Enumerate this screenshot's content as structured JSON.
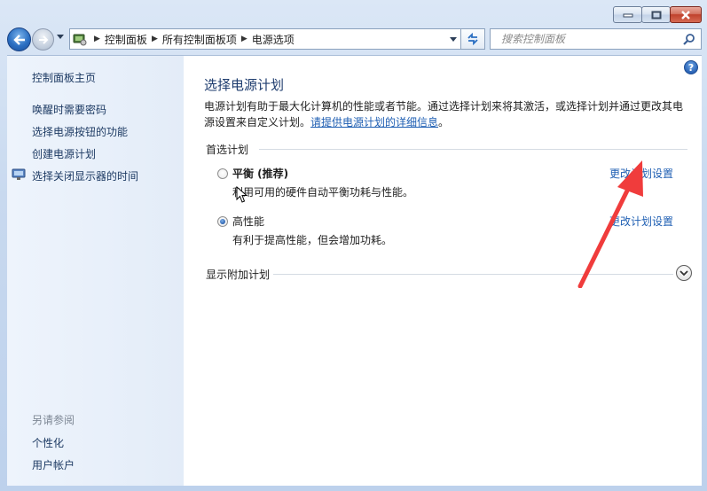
{
  "window": {
    "minimize_icon": "minimize-icon",
    "maximize_icon": "maximize-icon",
    "close_icon": "close-icon"
  },
  "nav": {
    "breadcrumbs": [
      "控制面板",
      "所有控制面板项",
      "电源选项"
    ],
    "search_placeholder": "搜索控制面板"
  },
  "sidebar": {
    "home": "控制面板主页",
    "links": [
      "唤醒时需要密码",
      "选择电源按钮的功能",
      "创建电源计划",
      "选择关闭显示器的时间"
    ],
    "see_also_header": "另请参阅",
    "see_also": [
      "个性化",
      "用户帐户"
    ]
  },
  "main": {
    "help": "?",
    "title": "选择电源计划",
    "description_1": "电源计划有助于最大化计算机的性能或者节能。通过选择计划来将其激活，或选择计划并通过更改其电源设置来自定义计划。",
    "description_link": "请提供电源计划的详细信息",
    "description_end": "。",
    "preferred_header": "首选计划",
    "plans": [
      {
        "name": "平衡 (推荐)",
        "description": "利用可用的硬件自动平衡功耗与性能。",
        "link": "更改计划设置",
        "selected": false
      },
      {
        "name": "高性能",
        "description": "有利于提高性能，但会增加功耗。",
        "link": "更改计划设置",
        "selected": true
      }
    ],
    "additional_header": "显示附加计划"
  },
  "colors": {
    "link": "#1f5fb3",
    "title": "#1e3c6e",
    "annotation_arrow": "#f03c3c"
  }
}
